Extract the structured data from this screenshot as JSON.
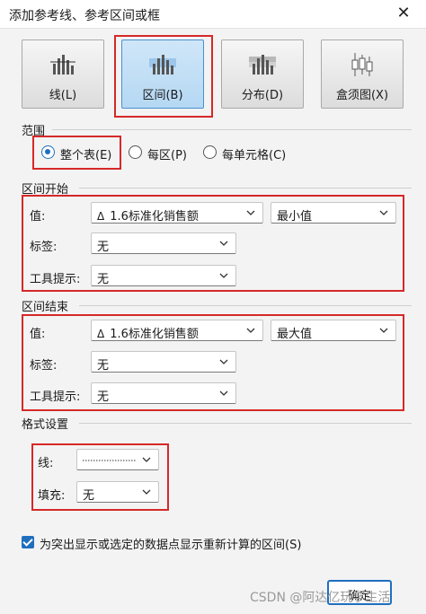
{
  "window": {
    "title": "添加参考线、参考区间或框",
    "close_glyph": "✕"
  },
  "type_buttons": [
    {
      "label": "线(L)"
    },
    {
      "label": "区间(B)"
    },
    {
      "label": "分布(D)"
    },
    {
      "label": "盒须图(X)"
    }
  ],
  "scope": {
    "label": "范围",
    "options": [
      "整个表(E)",
      "每区(P)",
      "每单元格(C)"
    ],
    "selected": "整个表(E)"
  },
  "band_start": {
    "label": "区间开始",
    "value_label": "值:",
    "value_field": "1.6标准化销售额",
    "value_field_icon": "Δ",
    "aggregation": "最小值",
    "label_label": "标签:",
    "label_value": "无",
    "tooltip_label": "工具提示:",
    "tooltip_value": "无"
  },
  "band_end": {
    "label": "区间结束",
    "value_label": "值:",
    "value_field": "1.6标准化销售额",
    "value_field_icon": "Δ",
    "aggregation": "最大值",
    "label_label": "标签:",
    "label_value": "无",
    "tooltip_label": "工具提示:",
    "tooltip_value": "无"
  },
  "format": {
    "label": "格式设置",
    "line_label": "线:",
    "fill_label": "填充:",
    "fill_value": "无"
  },
  "recalc_checkbox": {
    "label": "为突出显示或选定的数据点显示重新计算的区间(S)",
    "checked": true
  },
  "ok_button": {
    "label": "确定"
  },
  "watermark": "CSDN @阿达亿玩学生活",
  "colors": {
    "accent": "#1f6fbf",
    "highlight_box": "#d62828"
  }
}
